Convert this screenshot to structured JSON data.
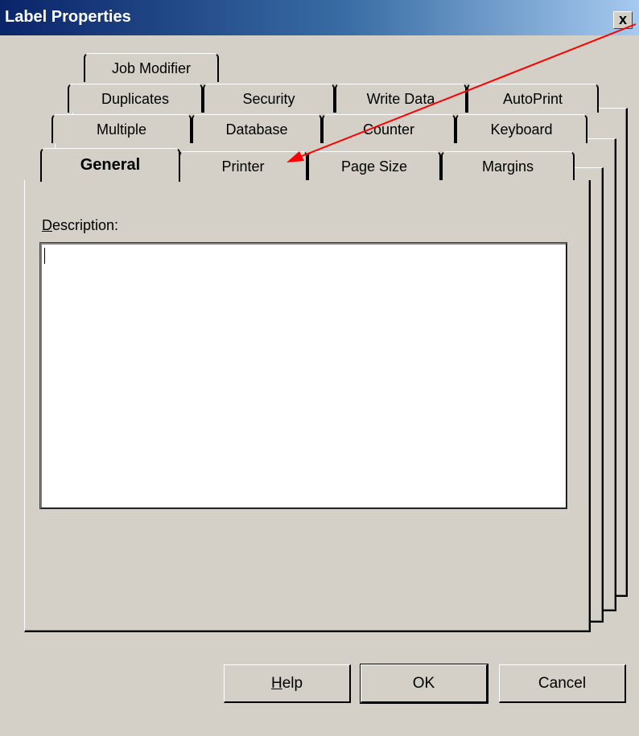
{
  "window": {
    "title": "Label Properties",
    "close_glyph": "x"
  },
  "tabs": {
    "row5": [
      "Job Modifier"
    ],
    "row4": [
      "Duplicates",
      "Security",
      "Write Data",
      "AutoPrint"
    ],
    "row3": [
      "Multiple",
      "Database",
      "Counter",
      "Keyboard"
    ],
    "row1": [
      "General",
      "Printer",
      "Page Size",
      "Margins"
    ],
    "active": "General"
  },
  "general": {
    "description_label_first": "D",
    "description_label_rest": "escription:",
    "description_value": ""
  },
  "buttons": {
    "help_underline": "H",
    "help_rest": "elp",
    "ok": "OK",
    "cancel": "Cancel"
  },
  "annotation": {
    "arrow_color": "#ff0000"
  },
  "colors": {
    "dialog_bg": "#d4d0c8",
    "title_start": "#0a246a",
    "title_end": "#a6caf0"
  }
}
